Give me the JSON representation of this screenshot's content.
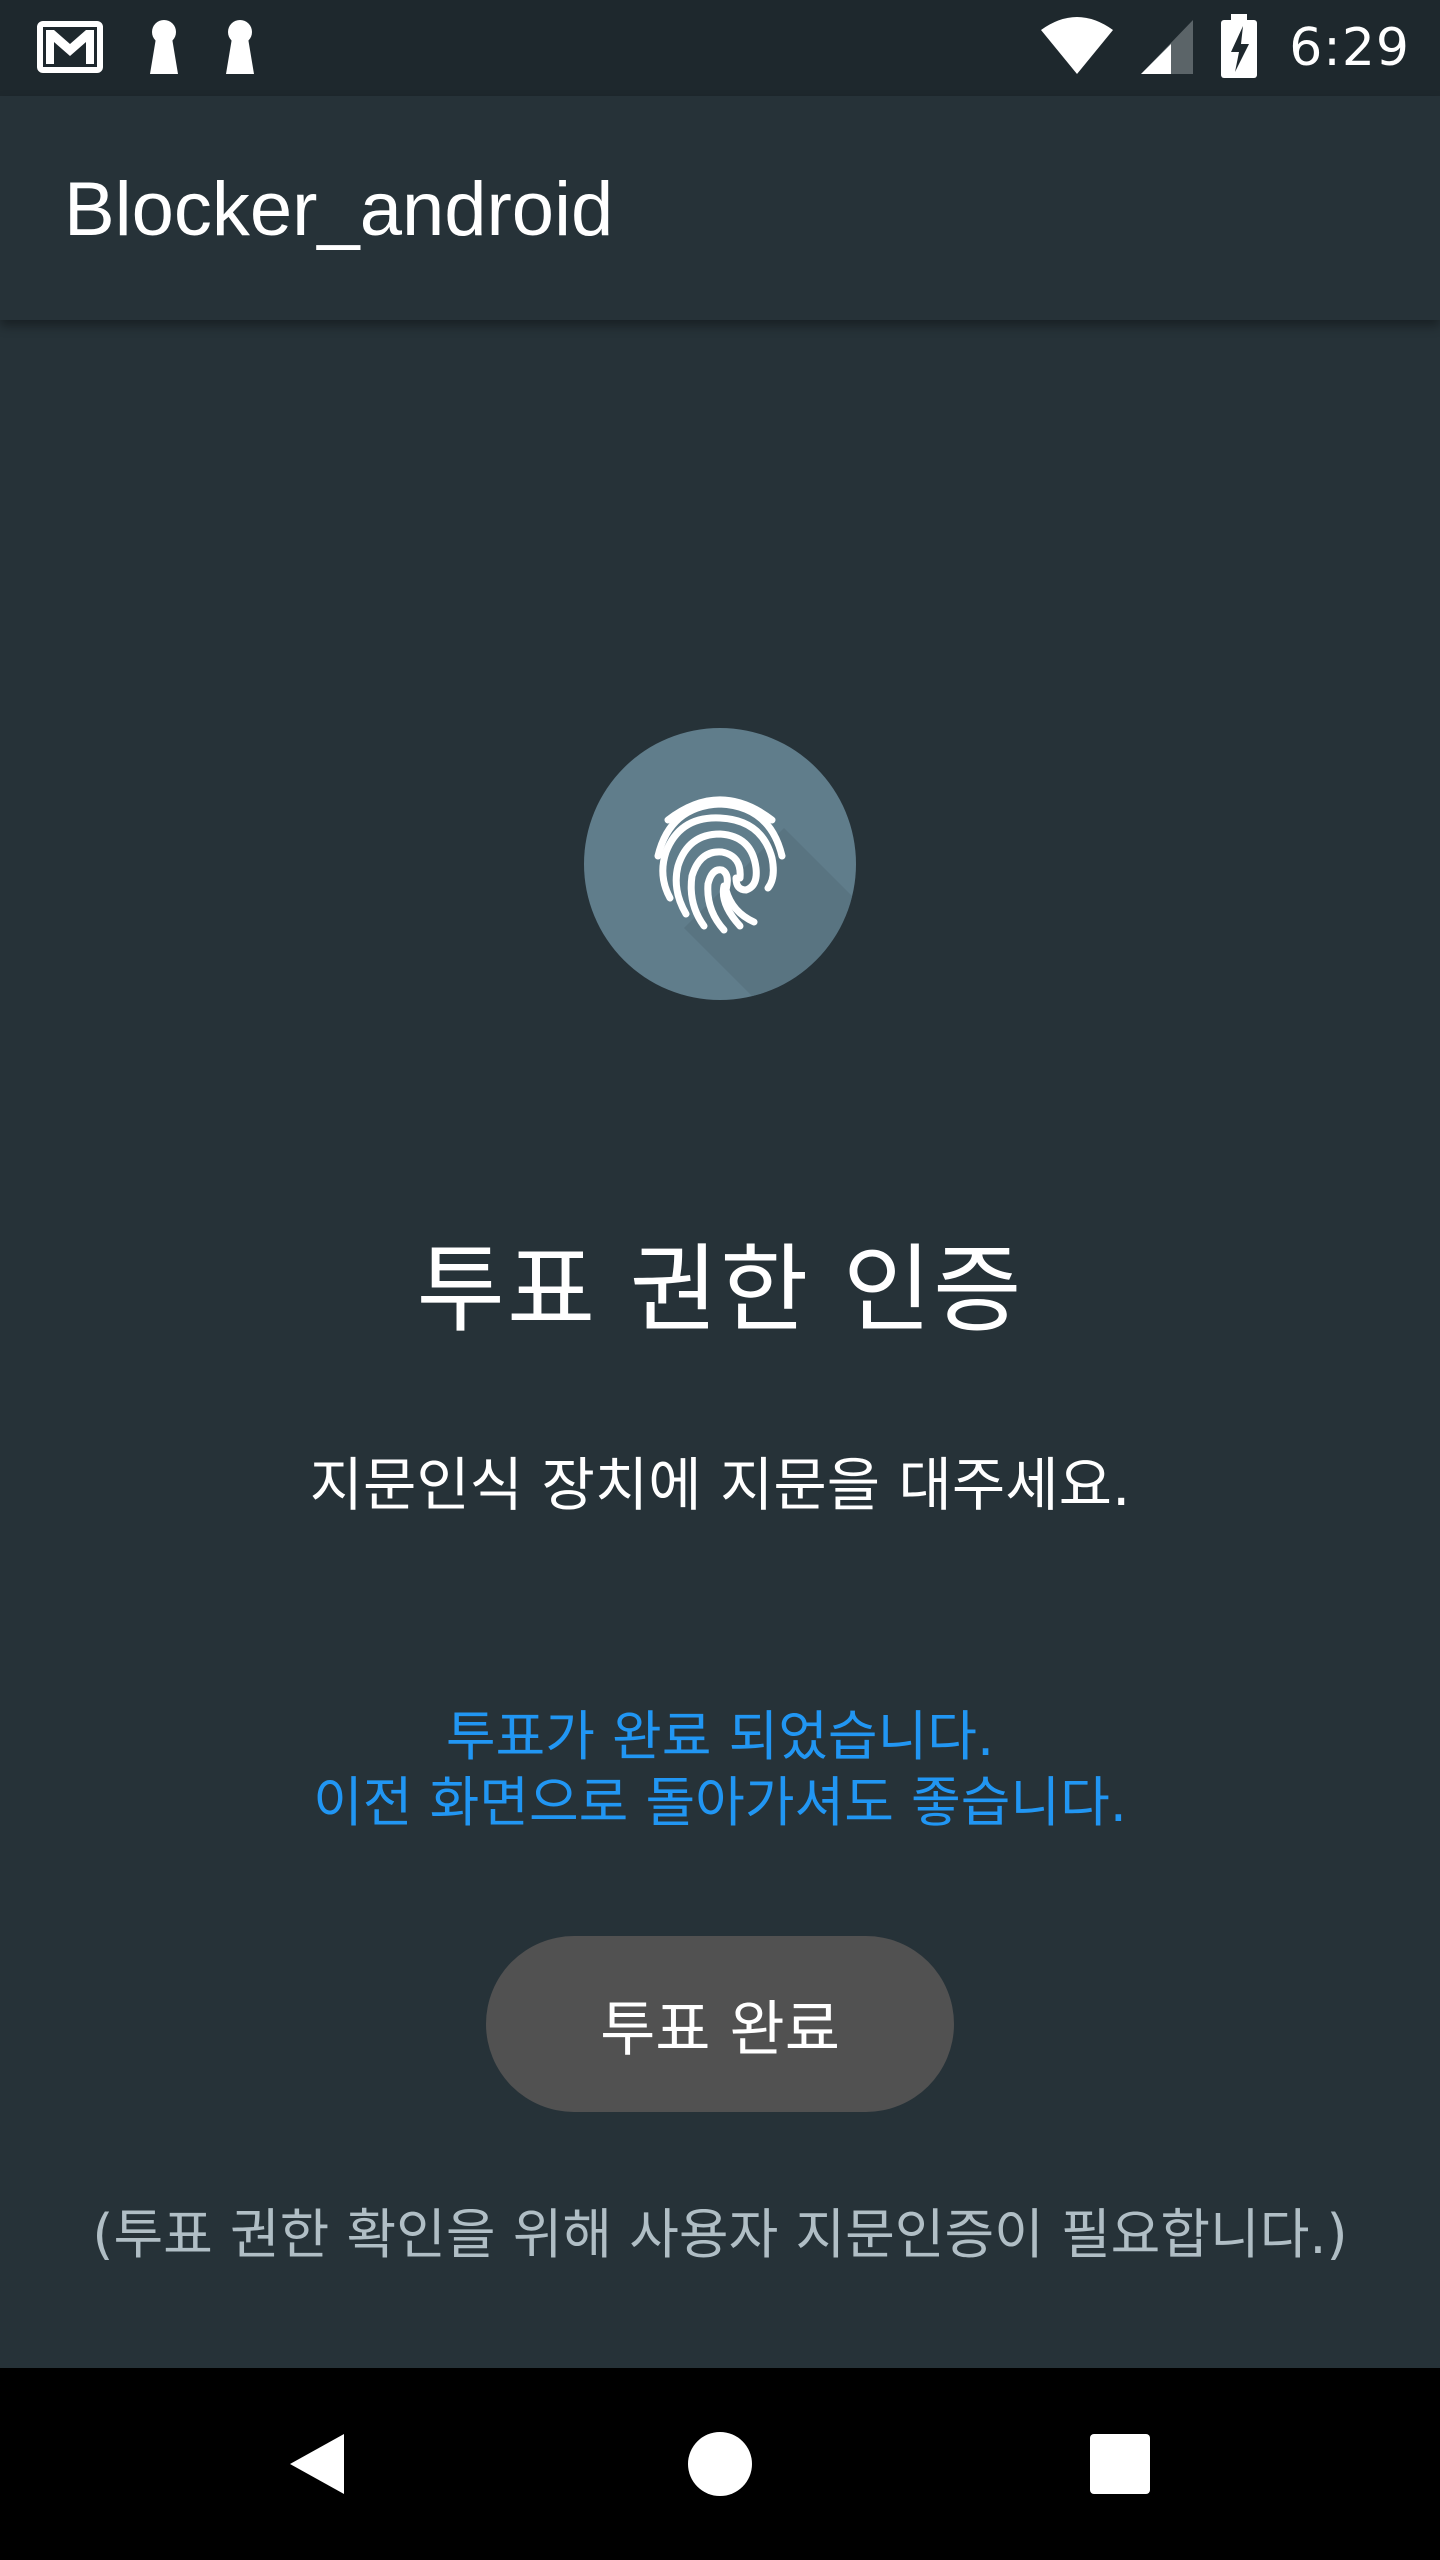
{
  "status_bar": {
    "time": "6:29",
    "icons": [
      "gmail-icon",
      "keyhole-icon",
      "keyhole-icon",
      "wifi-icon",
      "cell-signal-icon",
      "battery-charging-icon"
    ]
  },
  "app_bar": {
    "title": "Blocker_android"
  },
  "main": {
    "fingerprint_icon": "fingerprint-icon",
    "title": "투표 권한 인증",
    "instruction": "지문인식 장치에 지문을 대주세요.",
    "message_line1": "투표가 완료 되었습니다.",
    "message_line2": "이전 화면으로 돌아가셔도 좋습니다.",
    "button_label": "투표 완료",
    "footer_note": "(투표 권한 확인을 위해 사용자 지문인증이 필요합니다.)"
  },
  "colors": {
    "background": "#263238",
    "accent_circle": "#607d8b",
    "message": "#2196f3",
    "button": "#515151"
  },
  "nav_bar": {
    "icons": [
      "back-icon",
      "home-icon",
      "recents-icon"
    ]
  }
}
